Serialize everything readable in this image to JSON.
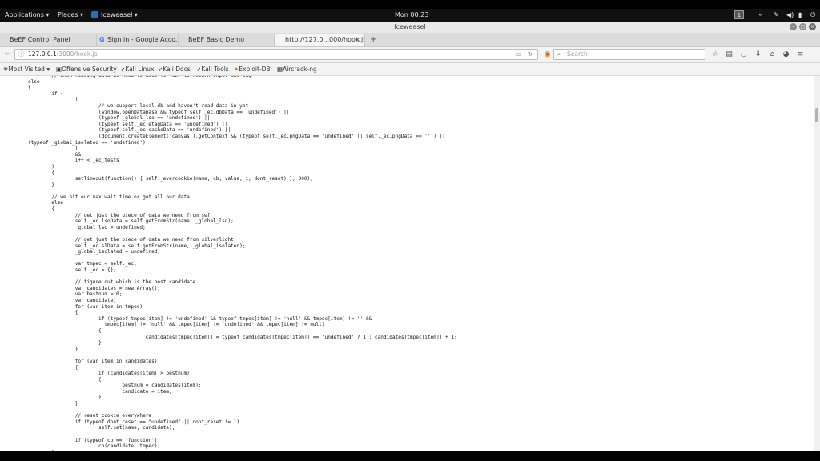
{
  "system_bar": {
    "applications": "Applications ▾",
    "places": "Places ▾",
    "active_app": "Iceweasel ▾",
    "clock": "Mon 00:23",
    "workspace": "1"
  },
  "window": {
    "title": "Iceweasel"
  },
  "tabs": [
    {
      "label": "BeEF Control Panel"
    },
    {
      "label": "Sign in - Google Acco..."
    },
    {
      "label": "BeEF Basic Demo"
    },
    {
      "label": "http://127.0...000/hook.js"
    }
  ],
  "toolbar": {
    "url_host": "127.0.0.1",
    "url_path": ":3000/hook.js",
    "search_placeholder": "Search"
  },
  "bookmarks": [
    {
      "label": "Most Visited ▾"
    },
    {
      "label": "Offensive Security"
    },
    {
      "label": "Kali Linux"
    },
    {
      "label": "Kali Docs"
    },
    {
      "label": "Kali Tools"
    },
    {
      "label": "Exploit-DB"
    },
    {
      "label": "Aircrack-ng"
    }
  ],
  "source_code": "        // when reading data we need to wait for swf to return input and png\nelse\n{\n        if (\n                (\n                        // we support local db and haven't read data in yet\n                        (window.openDatabase && typeof self._ec.dbData == 'undefined') ||\n                        (typeof _global_lso == 'undefined') ||\n                        (typeof self._ec.etagData == 'undefined') ||\n                        (typeof self._ec.cacheData == 'undefined') ||\n                        (document.createElement('canvas').getContext && (typeof self._ec.pngData == 'undefined' || self._ec.pngData == '')) ||\n(typeof _global_isolated == 'undefined')\n                )\n                &&\n                i++ < _ec_tests\n        )\n        {\n                setTimeout(function() { self._evercookie(name, cb, value, i, dont_reset) }, 300);\n        }\n\n        // we hit our max wait time or got all our data\n        else\n        {\n                // get just the piece of data we need from swf\n                self._ec.lsoData = self.getFromStr(name, _global_lso);\n                _global_lso = undefined;\n\n                // get just the piece of data we need from silverlight\n                self._ec.slData = self.getFromStr(name, _global_isolated);\n                _global_isolated = undefined;\n\n                var tmpec = self._ec;\n                self._ec = {};\n\n                // figure out which is the best candidate\n                var candidates = new Array();\n                var bestnum = 0;\n                var candidate;\n                for (var item in tmpec)\n                {\n                        if (typeof tmpec[item] != 'undefined' && typeof tmpec[item] != 'null' && tmpec[item] != '' &&\n                          tmpec[item] != 'null' && tmpec[item] != 'undefined' && tmpec[item] != null)\n                        {\n                                        candidates[tmpec[item]] = typeof candidates[tmpec[item]] == 'undefined' ? 1 : candidates[tmpec[item]] + 1;\n                        }\n                }\n\n                for (var item in candidates)\n                {\n                        if (candidates[item] > bestnum)\n                        {\n                                bestnum = candidates[item];\n                                candidate = item;\n                        }\n                }\n\n                // reset cookie everywhere\n                if (typeof dont_reset == \"undefined\" || dont_reset != 1)\n                        self.set(name, candidate);\n\n                if (typeof cb == 'function')\n                        cb(candidate, tmpec);\n        }"
}
